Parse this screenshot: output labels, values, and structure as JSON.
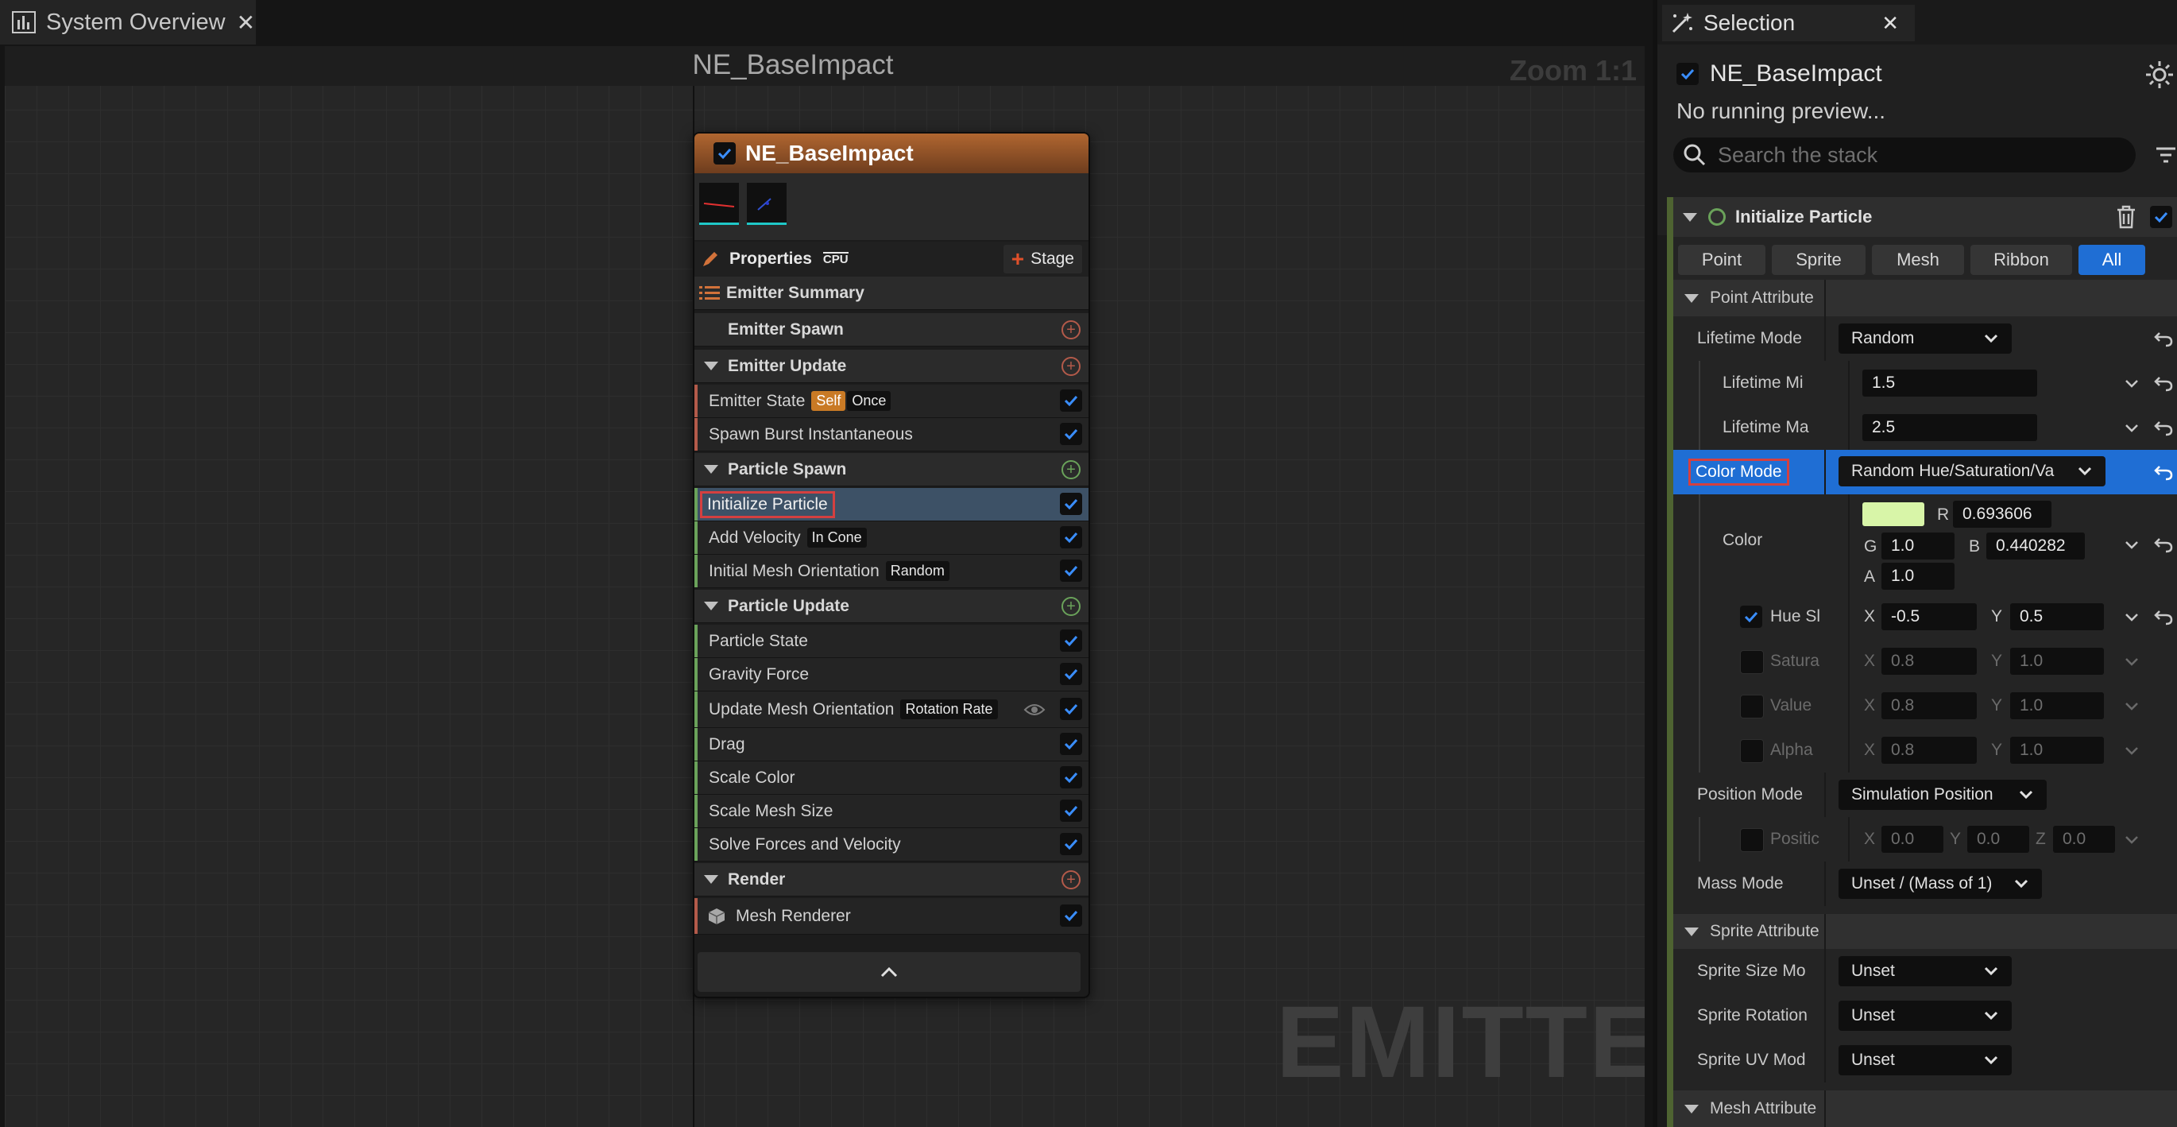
{
  "window": {
    "tab_title": "System Overview",
    "tab_close": "✕"
  },
  "graph": {
    "title": "NE_BaseImpact",
    "zoom": "Zoom 1:1",
    "watermark": "EMITTER"
  },
  "node": {
    "title": "NE_BaseImpact",
    "properties_label": "Properties",
    "cpu_label": "CPU",
    "stage_label": "Stage",
    "rows": {
      "emitter_summary": "Emitter Summary",
      "emitter_spawn": "Emitter Spawn",
      "emitter_update": "Emitter Update",
      "emitter_state": "Emitter State",
      "emitter_state_tag1": "Self",
      "emitter_state_tag2": "Once",
      "spawn_burst": "Spawn Burst Instantaneous",
      "particle_spawn": "Particle Spawn",
      "initialize_particle": "Initialize Particle",
      "add_velocity": "Add Velocity",
      "add_velocity_tag": "In Cone",
      "initial_mesh_orientation": "Initial Mesh Orientation",
      "initial_mesh_orientation_tag": "Random",
      "particle_update": "Particle Update",
      "particle_state": "Particle State",
      "gravity_force": "Gravity Force",
      "update_mesh_orientation": "Update Mesh Orientation",
      "update_mesh_orientation_tag": "Rotation Rate",
      "drag": "Drag",
      "scale_color": "Scale Color",
      "scale_mesh_size": "Scale Mesh Size",
      "solve_forces": "Solve Forces and Velocity",
      "render": "Render",
      "mesh_renderer": "Mesh Renderer"
    }
  },
  "selection": {
    "tab_title": "Selection",
    "tab_close": "✕",
    "emitter_name": "NE_BaseImpact",
    "status": "No running preview...",
    "search_placeholder": "Search the stack",
    "module_title": "Initialize Particle",
    "filters": [
      "Point",
      "Sprite",
      "Mesh",
      "Ribbon",
      "All"
    ],
    "active_filter": "All",
    "point_attributes": "Point Attribute",
    "lifetime_mode_label": "Lifetime Mode",
    "lifetime_mode_value": "Random",
    "lifetime_min_label": "Lifetime Mi",
    "lifetime_min_value": "1.5",
    "lifetime_max_label": "Lifetime Ma",
    "lifetime_max_value": "2.5",
    "color_mode_label": "Color Mode",
    "color_mode_value": "Random Hue/Saturation/Va",
    "color_label": "Color",
    "color_swatch": "#d8f5a8",
    "color_r_label": "R",
    "color_r": "0.693606",
    "color_g_label": "G",
    "color_g": "1.0",
    "color_b_label": "B",
    "color_b": "0.440282",
    "color_a_label": "A",
    "color_a": "1.0",
    "hue_label": "Hue Sl",
    "hue_x": "-0.5",
    "hue_y": "0.5",
    "sat_label": "Satura",
    "sat_x": "0.8",
    "sat_y": "1.0",
    "value_label": "Value",
    "value_x": "0.8",
    "value_y": "1.0",
    "alpha_label": "Alpha",
    "alpha_x": "0.8",
    "alpha_y": "1.0",
    "position_mode_label": "Position Mode",
    "position_mode_value": "Simulation Position",
    "position_label": "Positic",
    "pos_x": "0.0",
    "pos_y": "0.0",
    "pos_z": "0.0",
    "mass_mode_label": "Mass Mode",
    "mass_mode_value": "Unset / (Mass of 1)",
    "sprite_attributes": "Sprite Attribute",
    "sprite_size_label": "Sprite Size Mo",
    "sprite_size_value": "Unset",
    "sprite_rotation_label": "Sprite Rotation",
    "sprite_rotation_value": "Unset",
    "sprite_uv_label": "Sprite UV Mod",
    "sprite_uv_value": "Unset",
    "mesh_attributes": "Mesh Attribute",
    "axis_x": "X",
    "axis_y": "Y",
    "axis_z": "Z"
  },
  "colors": {
    "accent_blue": "#1f6ed4",
    "selected_row": "#3d5166",
    "node_header": "#b06630",
    "highlight_box": "#d44040"
  }
}
